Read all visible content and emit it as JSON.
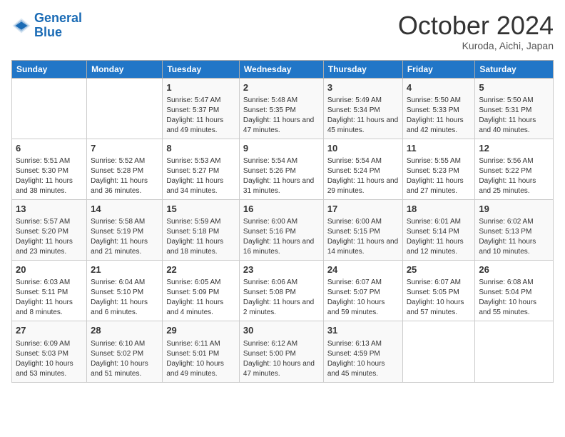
{
  "logo": {
    "line1": "General",
    "line2": "Blue"
  },
  "title": "October 2024",
  "subtitle": "Kuroda, Aichi, Japan",
  "days_of_week": [
    "Sunday",
    "Monday",
    "Tuesday",
    "Wednesday",
    "Thursday",
    "Friday",
    "Saturday"
  ],
  "weeks": [
    [
      {
        "day": "",
        "info": ""
      },
      {
        "day": "",
        "info": ""
      },
      {
        "day": "1",
        "info": "Sunrise: 5:47 AM\nSunset: 5:37 PM\nDaylight: 11 hours and 49 minutes."
      },
      {
        "day": "2",
        "info": "Sunrise: 5:48 AM\nSunset: 5:35 PM\nDaylight: 11 hours and 47 minutes."
      },
      {
        "day": "3",
        "info": "Sunrise: 5:49 AM\nSunset: 5:34 PM\nDaylight: 11 hours and 45 minutes."
      },
      {
        "day": "4",
        "info": "Sunrise: 5:50 AM\nSunset: 5:33 PM\nDaylight: 11 hours and 42 minutes."
      },
      {
        "day": "5",
        "info": "Sunrise: 5:50 AM\nSunset: 5:31 PM\nDaylight: 11 hours and 40 minutes."
      }
    ],
    [
      {
        "day": "6",
        "info": "Sunrise: 5:51 AM\nSunset: 5:30 PM\nDaylight: 11 hours and 38 minutes."
      },
      {
        "day": "7",
        "info": "Sunrise: 5:52 AM\nSunset: 5:28 PM\nDaylight: 11 hours and 36 minutes."
      },
      {
        "day": "8",
        "info": "Sunrise: 5:53 AM\nSunset: 5:27 PM\nDaylight: 11 hours and 34 minutes."
      },
      {
        "day": "9",
        "info": "Sunrise: 5:54 AM\nSunset: 5:26 PM\nDaylight: 11 hours and 31 minutes."
      },
      {
        "day": "10",
        "info": "Sunrise: 5:54 AM\nSunset: 5:24 PM\nDaylight: 11 hours and 29 minutes."
      },
      {
        "day": "11",
        "info": "Sunrise: 5:55 AM\nSunset: 5:23 PM\nDaylight: 11 hours and 27 minutes."
      },
      {
        "day": "12",
        "info": "Sunrise: 5:56 AM\nSunset: 5:22 PM\nDaylight: 11 hours and 25 minutes."
      }
    ],
    [
      {
        "day": "13",
        "info": "Sunrise: 5:57 AM\nSunset: 5:20 PM\nDaylight: 11 hours and 23 minutes."
      },
      {
        "day": "14",
        "info": "Sunrise: 5:58 AM\nSunset: 5:19 PM\nDaylight: 11 hours and 21 minutes."
      },
      {
        "day": "15",
        "info": "Sunrise: 5:59 AM\nSunset: 5:18 PM\nDaylight: 11 hours and 18 minutes."
      },
      {
        "day": "16",
        "info": "Sunrise: 6:00 AM\nSunset: 5:16 PM\nDaylight: 11 hours and 16 minutes."
      },
      {
        "day": "17",
        "info": "Sunrise: 6:00 AM\nSunset: 5:15 PM\nDaylight: 11 hours and 14 minutes."
      },
      {
        "day": "18",
        "info": "Sunrise: 6:01 AM\nSunset: 5:14 PM\nDaylight: 11 hours and 12 minutes."
      },
      {
        "day": "19",
        "info": "Sunrise: 6:02 AM\nSunset: 5:13 PM\nDaylight: 11 hours and 10 minutes."
      }
    ],
    [
      {
        "day": "20",
        "info": "Sunrise: 6:03 AM\nSunset: 5:11 PM\nDaylight: 11 hours and 8 minutes."
      },
      {
        "day": "21",
        "info": "Sunrise: 6:04 AM\nSunset: 5:10 PM\nDaylight: 11 hours and 6 minutes."
      },
      {
        "day": "22",
        "info": "Sunrise: 6:05 AM\nSunset: 5:09 PM\nDaylight: 11 hours and 4 minutes."
      },
      {
        "day": "23",
        "info": "Sunrise: 6:06 AM\nSunset: 5:08 PM\nDaylight: 11 hours and 2 minutes."
      },
      {
        "day": "24",
        "info": "Sunrise: 6:07 AM\nSunset: 5:07 PM\nDaylight: 10 hours and 59 minutes."
      },
      {
        "day": "25",
        "info": "Sunrise: 6:07 AM\nSunset: 5:05 PM\nDaylight: 10 hours and 57 minutes."
      },
      {
        "day": "26",
        "info": "Sunrise: 6:08 AM\nSunset: 5:04 PM\nDaylight: 10 hours and 55 minutes."
      }
    ],
    [
      {
        "day": "27",
        "info": "Sunrise: 6:09 AM\nSunset: 5:03 PM\nDaylight: 10 hours and 53 minutes."
      },
      {
        "day": "28",
        "info": "Sunrise: 6:10 AM\nSunset: 5:02 PM\nDaylight: 10 hours and 51 minutes."
      },
      {
        "day": "29",
        "info": "Sunrise: 6:11 AM\nSunset: 5:01 PM\nDaylight: 10 hours and 49 minutes."
      },
      {
        "day": "30",
        "info": "Sunrise: 6:12 AM\nSunset: 5:00 PM\nDaylight: 10 hours and 47 minutes."
      },
      {
        "day": "31",
        "info": "Sunrise: 6:13 AM\nSunset: 4:59 PM\nDaylight: 10 hours and 45 minutes."
      },
      {
        "day": "",
        "info": ""
      },
      {
        "day": "",
        "info": ""
      }
    ]
  ]
}
